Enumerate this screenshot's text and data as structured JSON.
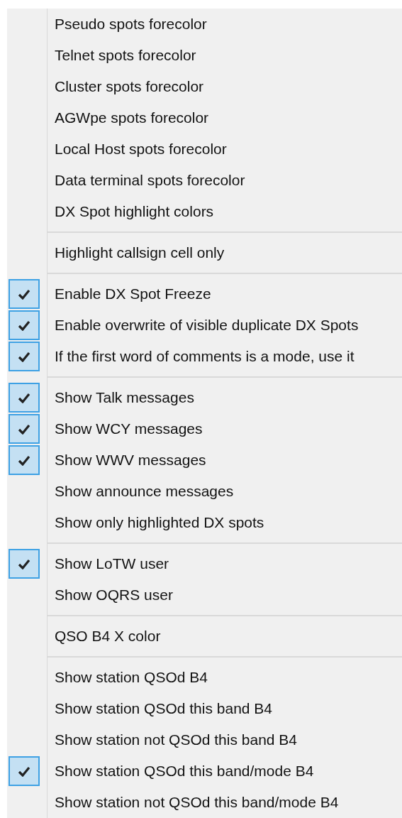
{
  "menu": {
    "groups": [
      {
        "items": [
          {
            "label": "Pseudo spots forecolor",
            "checked": false
          },
          {
            "label": "Telnet spots forecolor",
            "checked": false
          },
          {
            "label": "Cluster spots forecolor",
            "checked": false
          },
          {
            "label": "AGWpe spots forecolor",
            "checked": false
          },
          {
            "label": "Local Host spots forecolor",
            "checked": false
          },
          {
            "label": "Data terminal spots forecolor",
            "checked": false
          },
          {
            "label": "DX Spot highlight colors",
            "checked": false
          }
        ]
      },
      {
        "items": [
          {
            "label": "Highlight callsign cell only",
            "checked": false
          }
        ]
      },
      {
        "items": [
          {
            "label": "Enable DX Spot Freeze",
            "checked": true
          },
          {
            "label": "Enable overwrite of visible duplicate DX Spots",
            "checked": true
          },
          {
            "label": "If the first word of comments is a mode, use it",
            "checked": true
          }
        ]
      },
      {
        "items": [
          {
            "label": "Show Talk messages",
            "checked": true
          },
          {
            "label": "Show WCY messages",
            "checked": true
          },
          {
            "label": "Show WWV messages",
            "checked": true
          },
          {
            "label": "Show announce messages",
            "checked": false
          },
          {
            "label": "Show only highlighted DX spots",
            "checked": false
          }
        ]
      },
      {
        "items": [
          {
            "label": "Show LoTW user",
            "checked": true
          },
          {
            "label": "Show OQRS user",
            "checked": false
          }
        ]
      },
      {
        "items": [
          {
            "label": "QSO B4 X color",
            "checked": false
          }
        ]
      },
      {
        "items": [
          {
            "label": "Show station QSOd B4",
            "checked": false
          },
          {
            "label": "Show station QSOd this band B4",
            "checked": false
          },
          {
            "label": "Show station not QSOd this band B4",
            "checked": false
          },
          {
            "label": "Show station QSOd this band/mode B4",
            "checked": true
          },
          {
            "label": "Show station not QSOd this band/mode B4",
            "checked": false
          }
        ]
      }
    ]
  }
}
